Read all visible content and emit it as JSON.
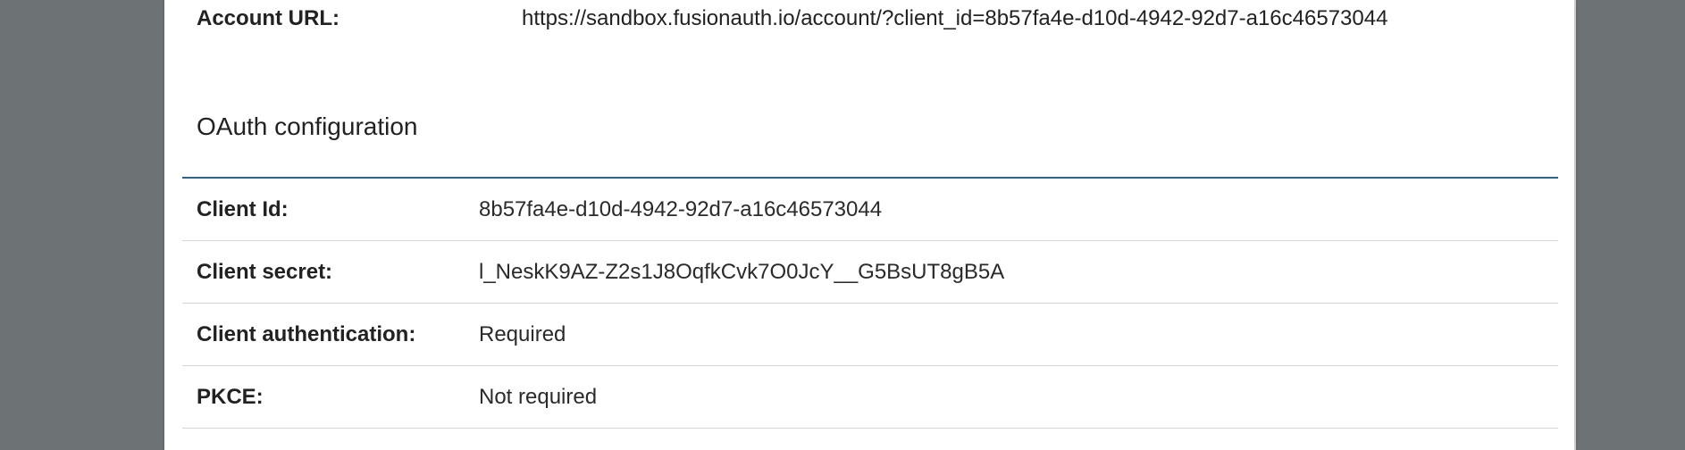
{
  "account": {
    "label": "Account URL:",
    "value": "https://sandbox.fusionauth.io/account/?client_id=8b57fa4e-d10d-4942-92d7-a16c46573044"
  },
  "oauth": {
    "title": "OAuth configuration",
    "rows": [
      {
        "label": "Client Id:",
        "value": "8b57fa4e-d10d-4942-92d7-a16c46573044"
      },
      {
        "label": "Client secret:",
        "value": "l_NeskK9AZ-Z2s1J8OqfkCvk7O0JcY__G5BsUT8gB5A"
      },
      {
        "label": "Client authentication:",
        "value": "Required"
      },
      {
        "label": "PKCE:",
        "value": "Not required"
      }
    ]
  }
}
